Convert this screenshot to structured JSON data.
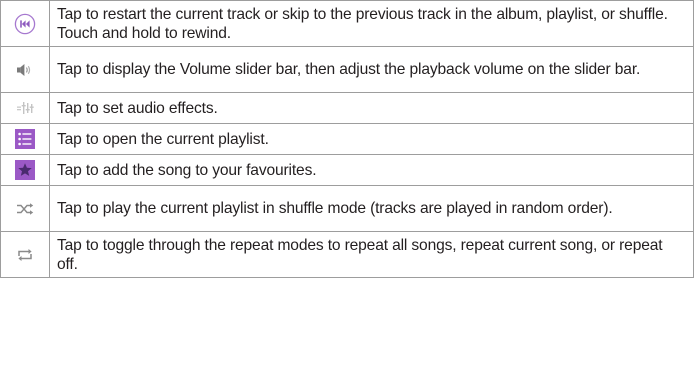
{
  "rows": [
    {
      "icon": "previous-track-icon",
      "text": "Tap to restart the current track or skip to the previous track in the album, playlist, or shuffle. Touch and hold to rewind."
    },
    {
      "icon": "volume-icon",
      "text": "Tap to display the Volume slider bar, then adjust the playback volume on the slider bar."
    },
    {
      "icon": "audio-effects-icon",
      "text": "Tap to set audio effects."
    },
    {
      "icon": "playlist-icon",
      "text": "Tap to open the current playlist."
    },
    {
      "icon": "favourite-star-icon",
      "text": "Tap to add the song to your favourites."
    },
    {
      "icon": "shuffle-icon",
      "text": "Tap to play the current playlist in shuffle mode (tracks are played in random order)."
    },
    {
      "icon": "repeat-icon",
      "text": "Tap to toggle through the repeat modes to repeat all songs, repeat current song, or repeat off."
    }
  ],
  "colors": {
    "accent_purple": "#9b59c6",
    "icon_gray": "#8a8a8a",
    "border": "#9d9d9d",
    "text": "#231f20"
  }
}
